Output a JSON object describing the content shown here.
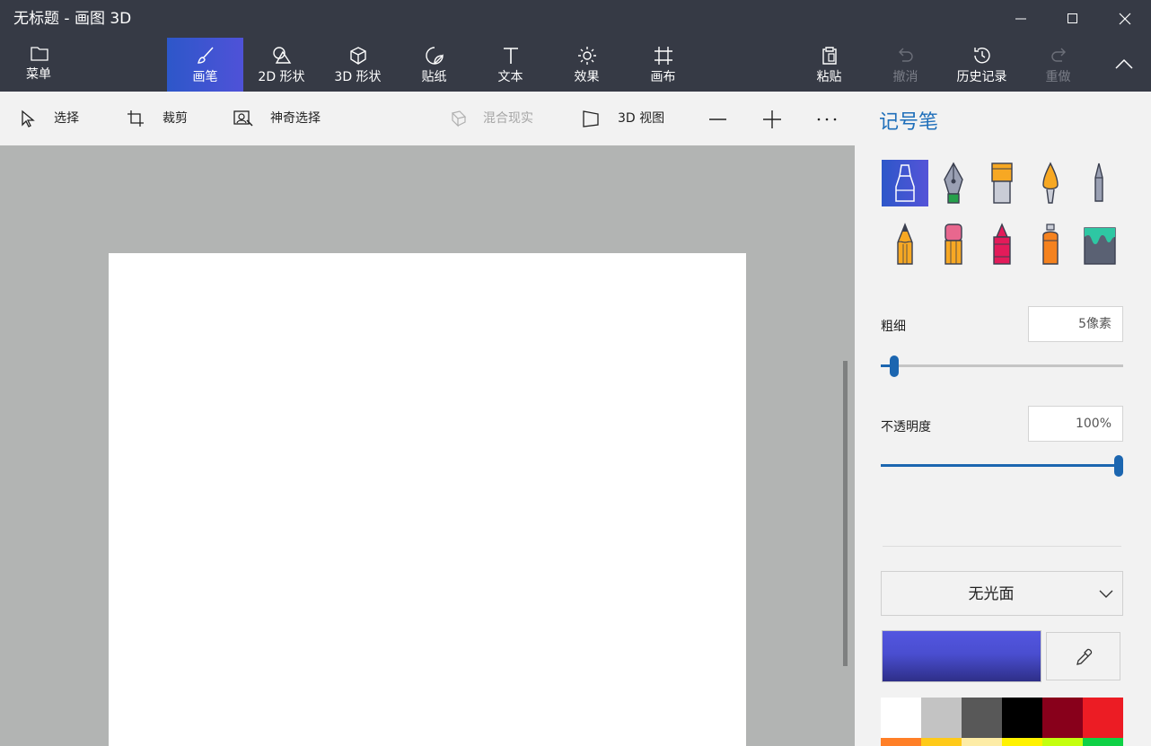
{
  "window": {
    "title": "无标题 - 画图 3D"
  },
  "ribbon": {
    "menu": "菜单",
    "tabs": [
      {
        "label": "画笔",
        "icon": "brush-icon",
        "active": true
      },
      {
        "label": "2D 形状",
        "icon": "2d-shapes-icon"
      },
      {
        "label": "3D 形状",
        "icon": "3d-shapes-icon"
      },
      {
        "label": "贴纸",
        "icon": "sticker-icon"
      },
      {
        "label": "文本",
        "icon": "text-icon"
      },
      {
        "label": "效果",
        "icon": "effects-icon"
      },
      {
        "label": "画布",
        "icon": "canvas-icon"
      }
    ],
    "actions": [
      {
        "label": "粘贴",
        "icon": "paste-icon",
        "enabled": true
      },
      {
        "label": "撤消",
        "icon": "undo-icon",
        "enabled": false
      },
      {
        "label": "历史记录",
        "icon": "history-icon",
        "enabled": true
      },
      {
        "label": "重做",
        "icon": "redo-icon",
        "enabled": false
      }
    ]
  },
  "toolbar": {
    "select": "选择",
    "crop": "裁剪",
    "magic_select": "神奇选择",
    "mixed_reality": "混合现实",
    "view_3d": "3D 视图",
    "zoom_out": "—",
    "zoom_in": "+",
    "more": "···"
  },
  "panel": {
    "title": "记号笔",
    "brushes": [
      "marker-icon",
      "calligraphy-pen-icon",
      "oil-brush-icon",
      "watercolor-icon",
      "pixel-pen-icon",
      "pencil-icon",
      "eraser-icon",
      "crayon-icon",
      "spray-can-icon",
      "fill-bucket-icon"
    ],
    "selected_brush": "marker-icon",
    "thickness": {
      "label": "粗细",
      "value": "5像素",
      "fraction": 0.04
    },
    "opacity": {
      "label": "不透明度",
      "value": "100%",
      "fraction": 1.0
    },
    "finish": "无光面",
    "current_color": "#4f53dc",
    "palette_row1": [
      "#ffffff",
      "#c3c3c3",
      "#585858",
      "#000000",
      "#88001b",
      "#ec1c24"
    ],
    "palette_row2": [
      "#ff7f27",
      "#ffca18",
      "#fdeca6",
      "#fff200",
      "#c4ff0e",
      "#0ed145"
    ]
  }
}
